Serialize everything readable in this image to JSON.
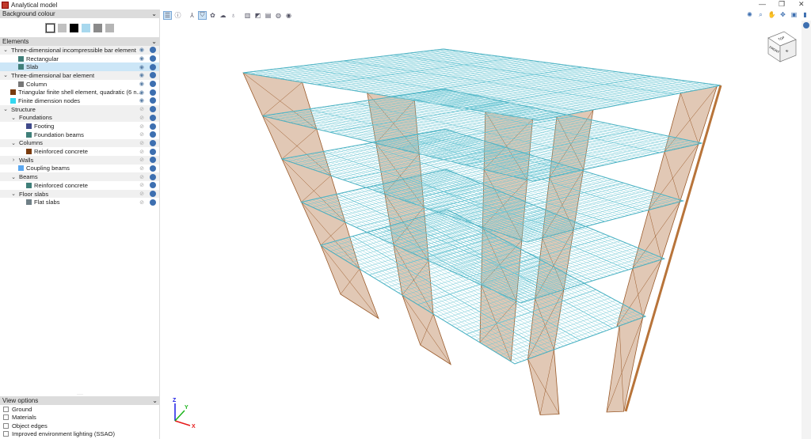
{
  "window": {
    "title": "Analytical model",
    "minimize": "—",
    "restore": "❐",
    "close": "✕"
  },
  "background": {
    "header": "Background colour",
    "swatches": [
      "#ffffff",
      "#c0c0c0",
      "#000000",
      "#a8d8ee",
      "#8a8a8a",
      "#b5b5b5"
    ]
  },
  "elements": {
    "header": "Elements",
    "items": [
      {
        "label": "Three-dimensional incompressible bar element",
        "level": 0,
        "chevron": "v",
        "color": null,
        "visible": true
      },
      {
        "label": "Rectangular",
        "level": 2,
        "color": "#3f7f79",
        "visible": true
      },
      {
        "label": "Slab",
        "level": 2,
        "color": "#3f7f79",
        "visible": true,
        "selected": true
      },
      {
        "label": "Three-dimensional bar element",
        "level": 0,
        "chevron": "v",
        "color": null,
        "visible": true
      },
      {
        "label": "Column",
        "level": 2,
        "color": "#777777",
        "visible": true
      },
      {
        "label": "Triangular finite shell element, quadratic (6 n...",
        "level": 1,
        "color": "#7a3b0e",
        "visible": true
      },
      {
        "label": "Finite dimension nodes",
        "level": 1,
        "color": "#33d8f0",
        "visible": true
      },
      {
        "label": "Structure",
        "level": 0,
        "chevron": "v",
        "color": null,
        "visible": false
      },
      {
        "label": "Foundations",
        "level": 1,
        "chevron": "v",
        "color": null,
        "visible": false
      },
      {
        "label": "Footing",
        "level": 3,
        "color": "#3f4a8a",
        "visible": false
      },
      {
        "label": "Foundation beams",
        "level": 3,
        "color": "#3f7f79",
        "visible": false
      },
      {
        "label": "Columns",
        "level": 1,
        "chevron": "v",
        "color": null,
        "visible": false
      },
      {
        "label": "Reinforced concrete",
        "level": 3,
        "color": "#7a3b0e",
        "visible": false
      },
      {
        "label": "Walls",
        "level": 1,
        "chevron": ">",
        "color": null,
        "visible": false
      },
      {
        "label": "Coupling beams",
        "level": 2,
        "color": "#5aa7f0",
        "visible": false
      },
      {
        "label": "Beams",
        "level": 1,
        "chevron": "v",
        "color": null,
        "visible": false
      },
      {
        "label": "Reinforced concrete",
        "level": 3,
        "color": "#3f7f79",
        "visible": false
      },
      {
        "label": "Floor slabs",
        "level": 1,
        "chevron": "v",
        "color": null,
        "visible": false
      },
      {
        "label": "Flat slabs",
        "level": 3,
        "color": "#6f7f86",
        "visible": false
      }
    ]
  },
  "view_options": {
    "header": "View options",
    "items": [
      {
        "label": "Ground",
        "checked": false
      },
      {
        "label": "Materials",
        "checked": false
      },
      {
        "label": "Object edges",
        "checked": false
      },
      {
        "label": "Improved environment lighting (SSAO)",
        "checked": false
      }
    ]
  },
  "toolbar": {
    "icons": [
      "model-tree-icon",
      "info-icon",
      "axes-icon",
      "shading-icon",
      "render-icon",
      "lighting-icon",
      "ground-icon",
      "section-icon",
      "clip-icon",
      "layers-icon",
      "material-icon",
      "hide-icon"
    ],
    "active": [
      0,
      3
    ]
  },
  "right_tools": [
    "zoom-extents-icon",
    "zoom-window-icon",
    "pan-icon",
    "orbit-icon",
    "view-icon",
    "book-icon"
  ],
  "viewcube": {
    "top": "TOP",
    "front": "FRONT",
    "right": "R"
  },
  "axes": {
    "x": "X",
    "y": "Y",
    "z": "Z"
  },
  "colors": {
    "mesh": "#6cc6d4",
    "panel": "#c89b78",
    "panel_edge": "#9a5a2a"
  }
}
